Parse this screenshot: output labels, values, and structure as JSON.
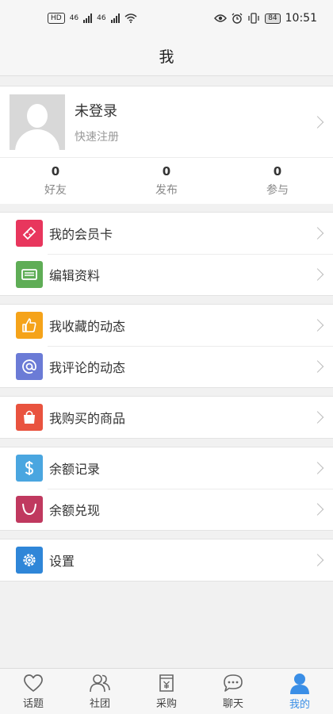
{
  "statusbar": {
    "battery": "84",
    "time": "10:51",
    "net1": "46",
    "net2": "46"
  },
  "navbar": {
    "title": "我"
  },
  "profile": {
    "name": "未登录",
    "subtitle": "快速注册",
    "stats": [
      {
        "value": "0",
        "label": "好友"
      },
      {
        "value": "0",
        "label": "发布"
      },
      {
        "value": "0",
        "label": "参与"
      }
    ]
  },
  "menu": {
    "member_card": "我的会员卡",
    "edit_profile": "编辑资料",
    "favorite_posts": "我收藏的动态",
    "commented_posts": "我评论的动态",
    "purchased_goods": "我购买的商品",
    "balance_records": "余额记录",
    "balance_redeem": "余额兑现",
    "settings": "设置"
  },
  "colors": {
    "member_card": "#e8365d",
    "edit_profile": "#5fad56",
    "favorite_posts": "#f5a31a",
    "commented_posts": "#6b7bd6",
    "purchased_goods": "#e9533f",
    "balance_records": "#4aa6e0",
    "balance_redeem": "#c0395f",
    "settings": "#2f86d8",
    "active_tab": "#3a8ee6"
  },
  "tabs": [
    {
      "label": "话题",
      "icon": "heart-icon"
    },
    {
      "label": "社团",
      "icon": "group-icon"
    },
    {
      "label": "采购",
      "icon": "purchase-icon"
    },
    {
      "label": "聊天",
      "icon": "chat-icon"
    },
    {
      "label": "我的",
      "icon": "user-icon",
      "active": true
    }
  ]
}
